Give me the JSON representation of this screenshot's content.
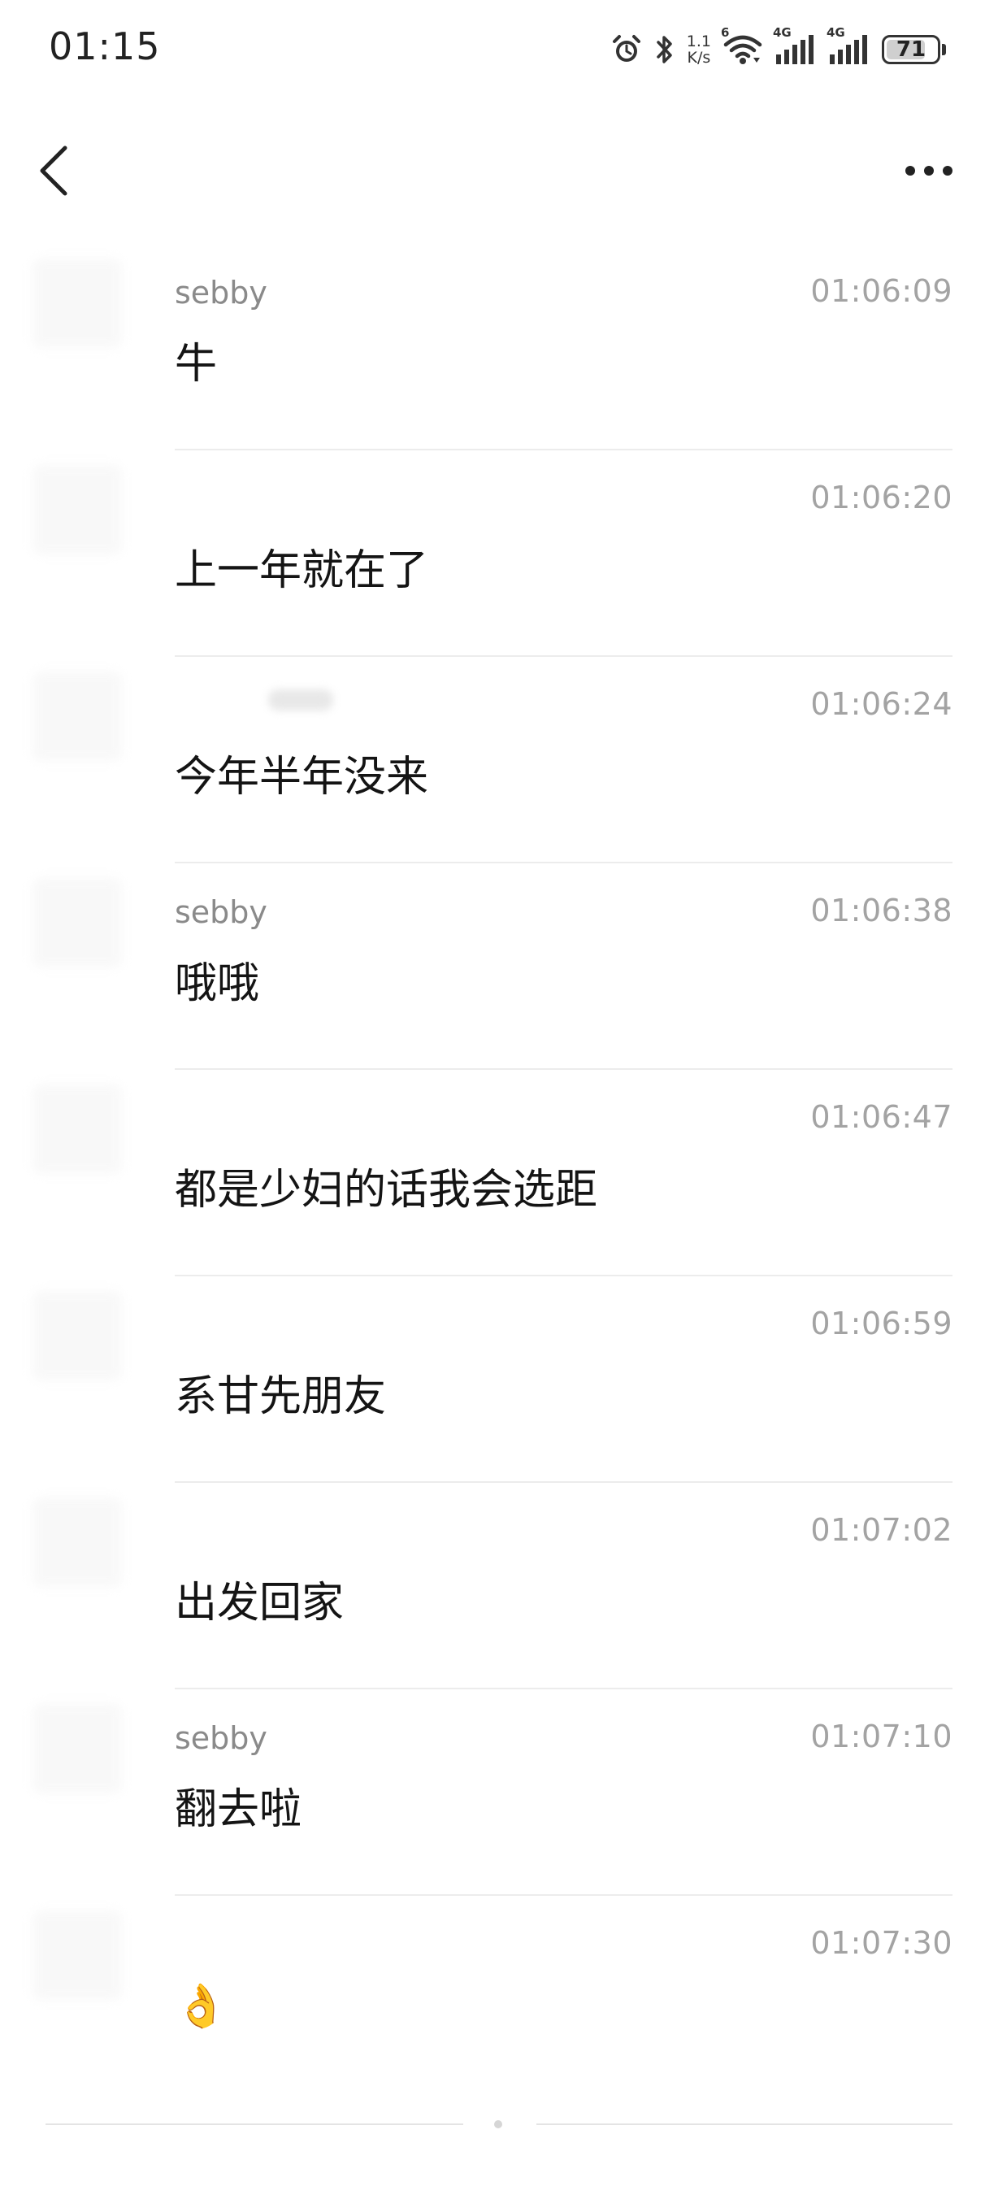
{
  "status_bar": {
    "time": "01:15",
    "net_speed_value": "1.1",
    "net_speed_unit": "K/s",
    "wifi_tag": "6",
    "signal1_tag": "4G",
    "signal2_tag": "4G",
    "battery_level": "71",
    "icons": [
      "alarm-icon",
      "bluetooth-icon",
      "wifi-icon",
      "signal-icon",
      "signal-icon",
      "battery-icon"
    ]
  },
  "nav": {
    "back_icon": "chevron-left-icon",
    "more_icon": "more-dots-icon"
  },
  "messages": [
    {
      "sender": "sebby",
      "time": "01:06:09",
      "text": "牛"
    },
    {
      "sender": "",
      "time": "01:06:20",
      "text": "上一年就在了"
    },
    {
      "sender": "",
      "time": "01:06:24",
      "text": "今年半年没来"
    },
    {
      "sender": "sebby",
      "time": "01:06:38",
      "text": "哦哦"
    },
    {
      "sender": "",
      "time": "01:06:47",
      "text": "都是少妇的话我会选距"
    },
    {
      "sender": "",
      "time": "01:06:59",
      "text": "系甘先朋友"
    },
    {
      "sender": "",
      "time": "01:07:02",
      "text": "出发回家"
    },
    {
      "sender": "sebby",
      "time": "01:07:10",
      "text": "翻去啦"
    },
    {
      "sender": "",
      "time": "01:07:30",
      "text": "👌"
    }
  ]
}
